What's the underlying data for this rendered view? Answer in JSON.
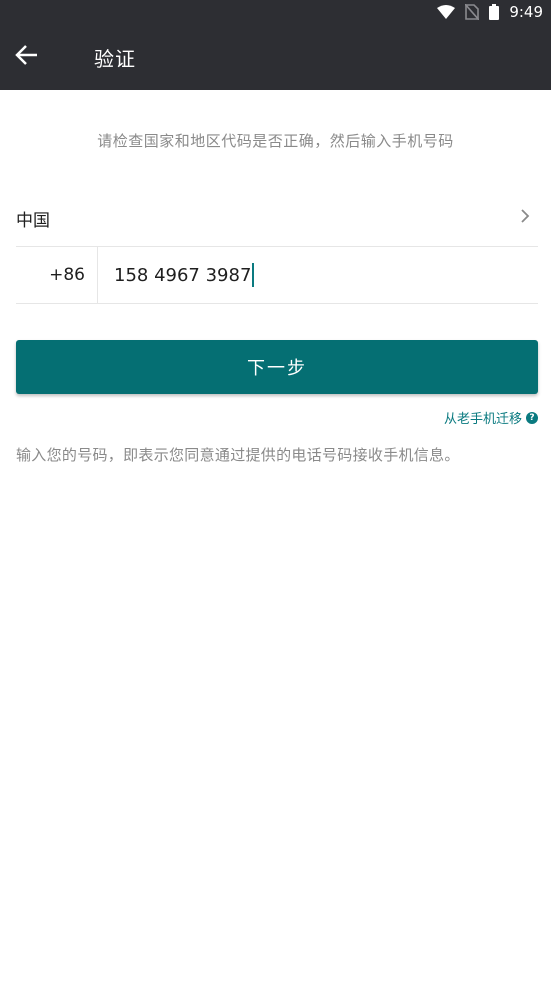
{
  "status_bar": {
    "time": "9:49",
    "icons": [
      "wifi-icon",
      "no-sim-icon",
      "battery-icon"
    ]
  },
  "toolbar": {
    "back_icon": "arrow-left-icon",
    "title": "验证"
  },
  "instruction": "请检查国家和地区代码是否正确，然后输入手机号码",
  "country": {
    "name": "中国",
    "chevron_icon": "chevron-right-icon"
  },
  "phone": {
    "country_code": "+86",
    "number": "158 4967 3987"
  },
  "next_button": {
    "label": "下一步"
  },
  "migrate": {
    "label": "从老手机迁移",
    "help_icon": "help-icon",
    "help_glyph": "?"
  },
  "consent": "输入您的号码，即表示您同意通过提供的电话号码接收手机信息。",
  "colors": {
    "header_bg": "#2d2e33",
    "accent": "#056f73",
    "link": "#0a7a80",
    "secondary_text": "#8a8a8a"
  }
}
